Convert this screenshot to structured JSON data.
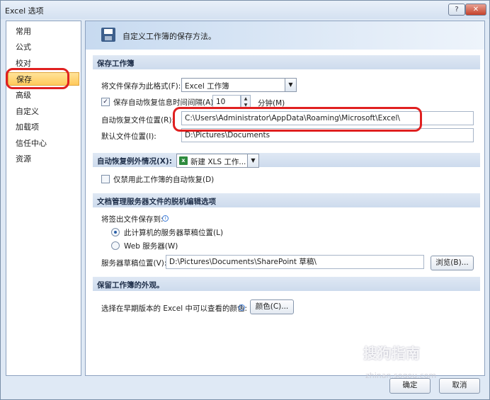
{
  "window": {
    "title": "Excel 选项",
    "help_label": "?",
    "close_label": "✕"
  },
  "sidebar": {
    "items": [
      {
        "label": "常用"
      },
      {
        "label": "公式"
      },
      {
        "label": "校对"
      },
      {
        "label": "保存"
      },
      {
        "label": "高级"
      },
      {
        "label": "自定义"
      },
      {
        "label": "加载项"
      },
      {
        "label": "信任中心"
      },
      {
        "label": "资源"
      }
    ],
    "active": "保存"
  },
  "banner": {
    "text": "自定义工作簿的保存方法。",
    "icon": "save-icon"
  },
  "save_section": {
    "header": "保存工作簿",
    "format_label": "将文件保存为此格式(F):",
    "format_value": "Excel 工作簿",
    "autorecover_checkbox_label": "保存自动恢复信息时间间隔(A)",
    "autorecover_checked": "✓",
    "autorecover_minutes": "10",
    "minutes_label": "分钟(M)",
    "autorecover_location_label": "自动恢复文件位置(R):",
    "autorecover_location_value": "C:\\Users\\Administrator\\AppData\\Roaming\\Microsoft\\Excel\\",
    "default_location_label": "默认文件位置(I):",
    "default_location_value": "D:\\Pictures\\Documents"
  },
  "exception_section": {
    "header": "自动恢复例外情况(X):",
    "workbook_value": "新建 XLS 工作...",
    "disable_label": "仅禁用此工作簿的自动恢复(D)"
  },
  "offline_section": {
    "header": "文档管理服务器文件的脱机编辑选项",
    "save_to_label": "将签出文件保存到:",
    "radio_local": "此计算机的服务器草稿位置(L)",
    "radio_web": "Web 服务器(W)",
    "drafts_label": "服务器草稿位置(V):",
    "drafts_value": "D:\\Pictures\\Documents\\SharePoint 草稿\\",
    "browse_label": "浏览(B)..."
  },
  "appearance_section": {
    "header": "保留工作簿的外观。",
    "colors_label": "选择在早期版本的 Excel 中可以查看的颜色:",
    "colors_button": "颜色(C)..."
  },
  "footer": {
    "ok_label": "确定",
    "cancel_label": "取消"
  },
  "watermark": {
    "text": "搜狗指南",
    "sub": "zhinan.sogou.com"
  },
  "colors": {
    "highlight": "#e02020",
    "accent": "#2a5fa8",
    "active_item": "#ffc95a"
  }
}
